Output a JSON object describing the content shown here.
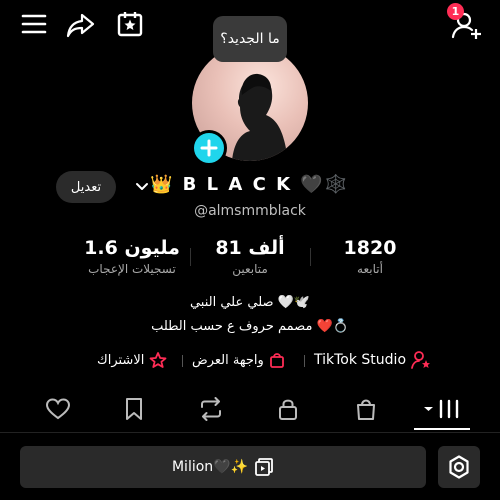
{
  "header": {
    "notification_count": "1",
    "tooltip_text": "ما الجديد؟"
  },
  "profile": {
    "edit_label": "تعديل",
    "display_name": "👑 B L A C K 🖤🕸️",
    "username": "@almsmmblack"
  },
  "stats": [
    {
      "value": "1.6 مليون",
      "label": "تسجيلات الإعجاب"
    },
    {
      "value": "81 ألف",
      "label": "متابعين"
    },
    {
      "value": "1820",
      "label": "أتابعه"
    }
  ],
  "bio": {
    "line1": "صلي علي النبي 🤍🕊️",
    "line2": "مصمم حروف ع حسب الطلب ❤️💍"
  },
  "links": {
    "subscribe": "الاشتراك",
    "showcase": "واجهة العرض",
    "studio": "TikTok Studio"
  },
  "tabs": [
    "liked",
    "favorites",
    "reposts",
    "private",
    "shop",
    "videos"
  ],
  "bottom": {
    "playlist_label": "Milion🖤✨"
  },
  "colors": {
    "background": "#000000",
    "accent_cyan": "#20d5ec",
    "badge_red": "#ff2d55",
    "tiktok_pink": "#fe2c55"
  },
  "icons": {
    "menu": "hamburger-icon",
    "share": "share-arrow-icon",
    "calendar": "calendar-star-icon",
    "add_user": "add-user-icon",
    "settings": "gear-icon"
  }
}
